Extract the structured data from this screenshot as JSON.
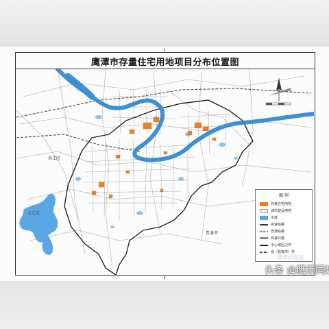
{
  "page": {
    "title": "鹰潭市存量住宅用地项目分布位置图"
  },
  "map": {
    "place_labels": [
      {
        "id": "left-place-1",
        "text": "余江区"
      },
      {
        "id": "left-place-2",
        "text": "余江区"
      },
      {
        "id": "right-place",
        "text": "贵溪市"
      }
    ],
    "colors": {
      "river": "#3d8fd6",
      "lake": "#5aa7e6",
      "existing_residential_plot": "#e8822a",
      "boundary": "#222222",
      "road": "#b8b8b8",
      "railway": "#555555"
    }
  },
  "legend": {
    "title": "图 例",
    "items": [
      {
        "label": "存量住宅用地",
        "color": "#e8822a"
      },
      {
        "label": "城市建设用地",
        "color": "#f3f3f3"
      },
      {
        "label": "水域",
        "color": "#5aa7e6"
      },
      {
        "label": "高速铁路",
        "color": "#333333"
      },
      {
        "label": "普通铁路",
        "color": "#777777"
      },
      {
        "label": "高速公路",
        "color": "#888888"
      },
      {
        "label": "中心城区边界",
        "color": "#222222"
      },
      {
        "label": "省（县级市）界",
        "color": "#444444"
      }
    ]
  },
  "watermark": {
    "text": "头条 @鹰潭同城会",
    "faint_text": "鹰潭同城会"
  }
}
